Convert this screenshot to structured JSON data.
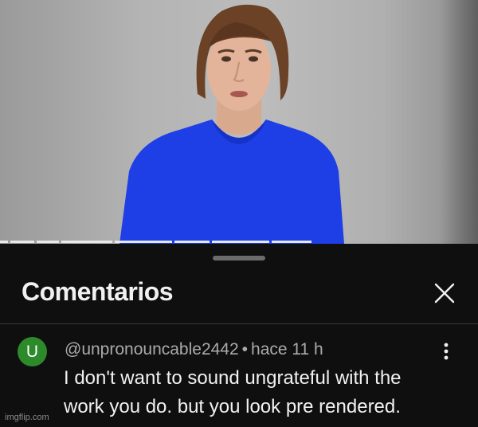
{
  "sheet": {
    "title": "Comentarios"
  },
  "comment": {
    "avatar_letter": "U",
    "avatar_color": "#2d8a2b",
    "author": "@unpronouncable2442",
    "separator": "•",
    "time": "hace 11 h",
    "text": "I don't want to sound ungrateful with the work you do. but you look pre rendered."
  },
  "icons": {
    "close": "close-icon",
    "more": "more-vert-icon"
  },
  "watermark": "imgflip.com"
}
